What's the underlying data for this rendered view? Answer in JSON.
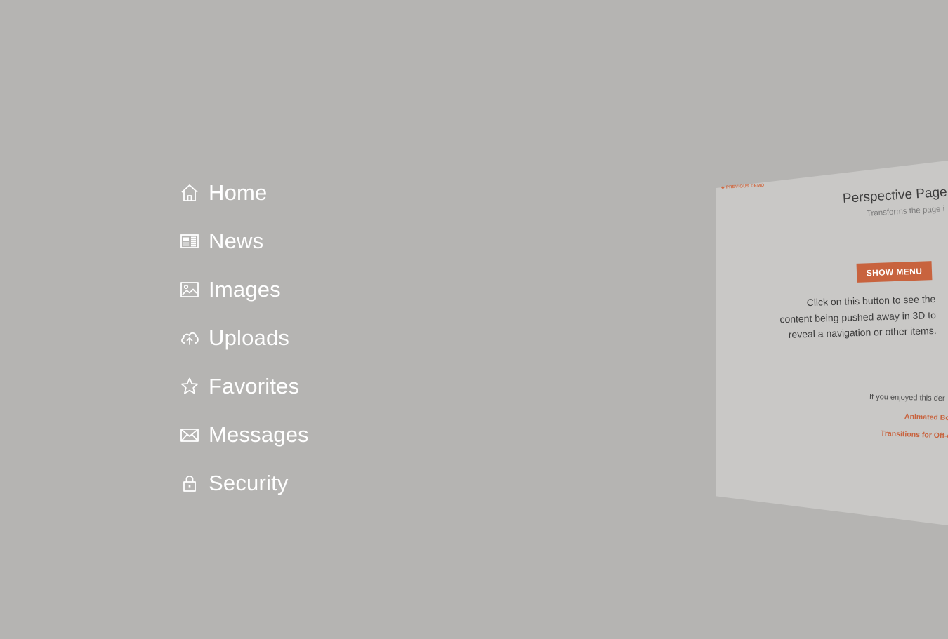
{
  "menu": {
    "items": [
      {
        "label": "Home",
        "icon": "home-icon"
      },
      {
        "label": "News",
        "icon": "news-icon"
      },
      {
        "label": "Images",
        "icon": "image-icon"
      },
      {
        "label": "Uploads",
        "icon": "cloud-upload-icon"
      },
      {
        "label": "Favorites",
        "icon": "star-icon"
      },
      {
        "label": "Messages",
        "icon": "envelope-icon"
      },
      {
        "label": "Security",
        "icon": "lock-icon"
      }
    ]
  },
  "page": {
    "previous_demo": "◆ Previous Demo",
    "title": "Perspective Page",
    "subtitle": "Transforms the page i",
    "button_label": "SHOW MENU",
    "description": "Click on this button to see the content being pushed away in 3D to reveal a navigation or other items.",
    "enjoy_text": "If you enjoyed this der",
    "link_1": "Animated Bo",
    "link_2": "Transitions for Off-c"
  },
  "colors": {
    "background": "#b5b4b2",
    "page": "#c9c8c6",
    "accent": "#c8633e",
    "menu_text": "#ffffff"
  }
}
